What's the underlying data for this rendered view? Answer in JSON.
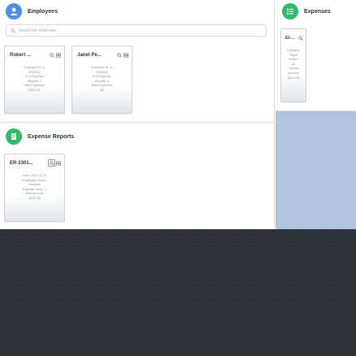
{
  "employees": {
    "title": "Employees",
    "search_placeholder": "Search for employee",
    "cards": [
      {
        "name": "Robert ...",
        "lines": [
          "Employee Id: A-",
          "0000001",
          "# of Expense",
          "Reports: 1",
          "Total Expenses:",
          "$222.34"
        ]
      },
      {
        "name": "Janet Pe...",
        "lines": [
          "Employee Id: A-",
          "0000002",
          "# of Expense",
          "Reports: 0",
          "Total Expenses:",
          "$0"
        ]
      }
    ]
  },
  "expenses": {
    "title": "Expenses",
    "card": {
      "name": "El-...",
      "lines": [
        "Category:",
        "Flight",
        "Vendor:",
        "Air",
        "Canada",
        "Amount:",
        "$222.34"
      ]
    }
  },
  "expense_reports": {
    "title": "Expense Reports",
    "card": {
      "name": "ER-2301...",
      "lines": [
        "Date: 2023-01-31",
        "Employee: Robert",
        "Martinez",
        "Expense Items: 1",
        "Total Amount:",
        "$222.34"
      ]
    }
  },
  "colors": {
    "accent_blue": "#4b8fe8",
    "accent_green": "#33b96a",
    "fill_blue": "#b2c3df",
    "background_dark": "#2a3037"
  }
}
